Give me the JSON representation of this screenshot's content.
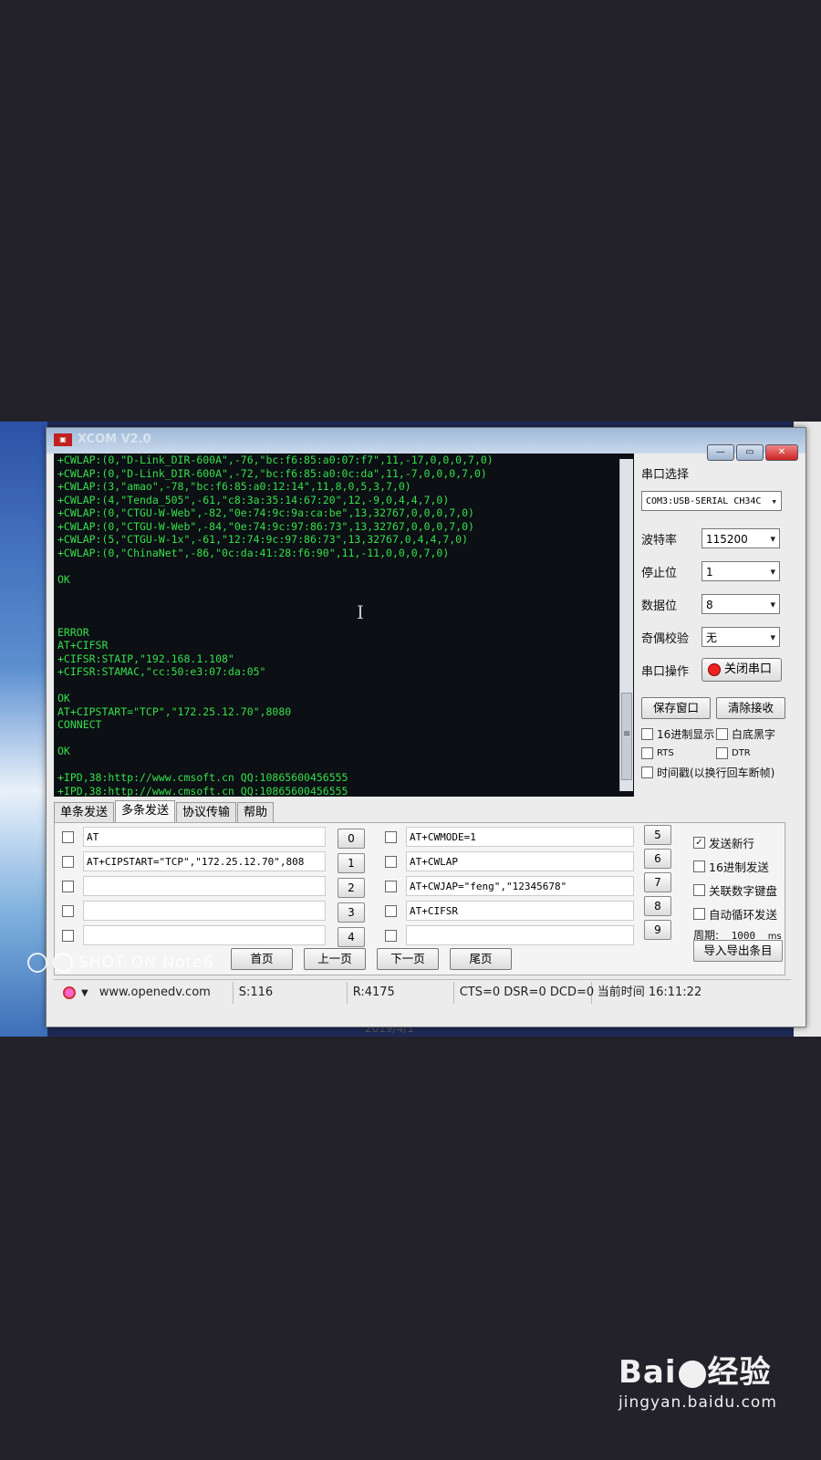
{
  "window": {
    "title": "XCOM V2.0",
    "min_label": "—",
    "max_label": "▭",
    "close_label": "✕"
  },
  "console_lines": [
    "+CWLAP:(0,\"D-Link_DIR-600A\",-76,\"bc:f6:85:a0:07:f7\",11,-17,0,0,0,7,0)",
    "+CWLAP:(0,\"D-Link_DIR-600A\",-72,\"bc:f6:85:a0:0c:da\",11,-7,0,0,0,7,0)",
    "+CWLAP:(3,\"amao\",-78,\"bc:f6:85:a0:12:14\",11,8,0,5,3,7,0)",
    "+CWLAP:(4,\"Tenda_505\",-61,\"c8:3a:35:14:67:20\",12,-9,0,4,4,7,0)",
    "+CWLAP:(0,\"CTGU-W-Web\",-82,\"0e:74:9c:9a:ca:be\",13,32767,0,0,0,7,0)",
    "+CWLAP:(0,\"CTGU-W-Web\",-84,\"0e:74:9c:97:86:73\",13,32767,0,0,0,7,0)",
    "+CWLAP:(5,\"CTGU-W-1x\",-61,\"12:74:9c:97:86:73\",13,32767,0,4,4,7,0)",
    "+CWLAP:(0,\"ChinaNet\",-86,\"0c:da:41:28:f6:90\",11,-11,0,0,0,7,0)",
    "",
    "OK",
    "",
    "",
    "",
    "ERROR",
    "AT+CIFSR",
    "+CIFSR:STAIP,\"192.168.1.108\"",
    "+CIFSR:STAMAC,\"cc:50:e3:07:da:05\"",
    "",
    "OK",
    "AT+CIPSTART=\"TCP\",\"172.25.12.70\",8080",
    "CONNECT",
    "",
    "OK",
    "",
    "+IPD,38:http://www.cmsoft.cn QQ:10865600456555",
    "+IPD,38:http://www.cmsoft.cn QQ:10865600456555",
    "+IPD,38:http://www.cmsoft.cn QQ:10865600456555"
  ],
  "serial": {
    "port_title": "串口选择",
    "port_value": "COM3:USB-SERIAL CH34C",
    "baud_label": "波特率",
    "baud_value": "115200",
    "stop_label": "停止位",
    "stop_value": "1",
    "data_label": "数据位",
    "data_value": "8",
    "parity_label": "奇偶校验",
    "parity_value": "无",
    "op_label": "串口操作",
    "close_btn": "关闭串口",
    "save_btn": "保存窗口",
    "clear_btn": "清除接收",
    "hex_display": "16进制显示",
    "white_bg": "白底黑字",
    "rts": "RTS",
    "dtr": "DTR",
    "timestamp": "时间戳(以换行回车断帧)"
  },
  "tabs": [
    "单条发送",
    "多条发送",
    "协议传输",
    "帮助"
  ],
  "commands_left": [
    "AT",
    "AT+CIPSTART=\"TCP\",\"172.25.12.70\",808",
    "",
    "",
    ""
  ],
  "commands_right": [
    "AT+CWMODE=1",
    "AT+CWLAP",
    "AT+CWJAP=\"feng\",\"12345678\"",
    "AT+CIFSR",
    ""
  ],
  "nums_left": [
    "0",
    "1",
    "2",
    "3",
    "4"
  ],
  "nums_right": [
    "5",
    "6",
    "7",
    "8",
    "9"
  ],
  "send_opts": {
    "newline": "发送新行",
    "newline_checked": true,
    "hex_send": "16进制发送",
    "keypad": "关联数字键盘",
    "auto_loop": "自动循环发送",
    "period_label": "周期:",
    "period_value": "1000",
    "period_unit": "ms",
    "import_btn": "导入导出条目"
  },
  "pager": [
    "首页",
    "上一页",
    "下一页",
    "尾页"
  ],
  "status": {
    "url": "www.openedv.com",
    "sent": "S:116",
    "recv": "R:4175",
    "lines": "CTS=0 DSR=0 DCD=0",
    "time": "当前时间 16:11:22"
  },
  "behind_text": "2019/4/1",
  "watermark": "SHOT ON Note6",
  "baidu": {
    "brand_left": "Bai",
    "brand_right": "经验",
    "site": "jingyan.baidu.com"
  }
}
